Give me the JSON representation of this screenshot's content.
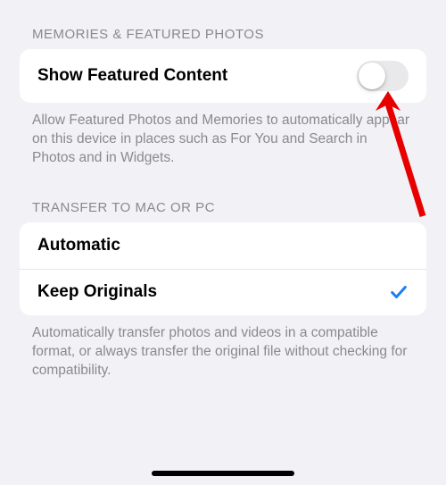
{
  "sections": {
    "memories": {
      "header": "MEMORIES & FEATURED PHOTOS",
      "row_label": "Show Featured Content",
      "toggle_on": false,
      "footer": "Allow Featured Photos and Memories to automatically appear on this device in places such as For You and Search in Photos and in Widgets."
    },
    "transfer": {
      "header": "TRANSFER TO MAC OR PC",
      "option_automatic": "Automatic",
      "option_keep_originals": "Keep Originals",
      "selected": "keep_originals",
      "footer": "Automatically transfer photos and videos in a compatible format, or always transfer the original file without checking for compatibility."
    }
  },
  "annotation": {
    "arrow_color": "#e60000"
  },
  "colors": {
    "check": "#157efb"
  }
}
